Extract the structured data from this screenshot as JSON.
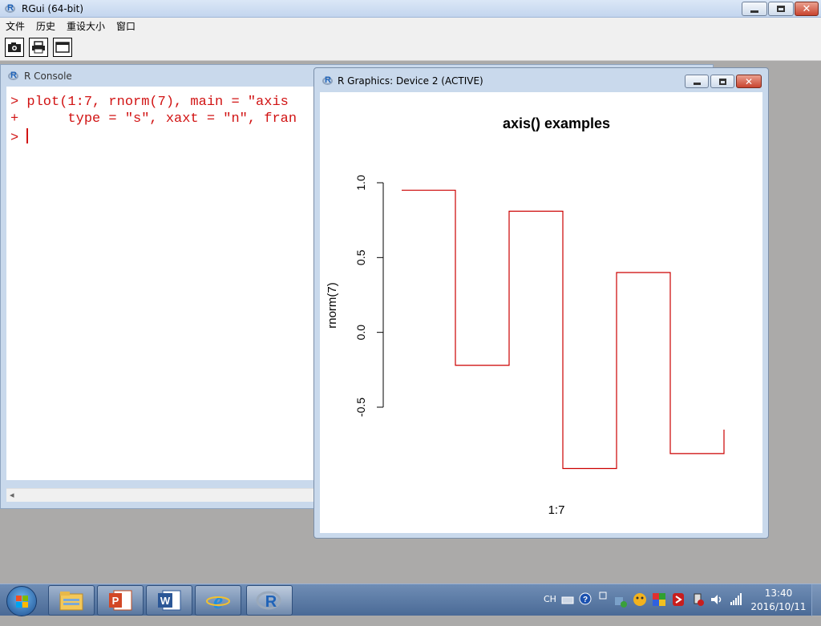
{
  "app": {
    "title": "RGui (64-bit)"
  },
  "menu": {
    "items": [
      "文件",
      "历史",
      "重设大小",
      "窗口"
    ]
  },
  "toolbar": {
    "icons": [
      "camera-icon",
      "print-icon",
      "window-icon"
    ]
  },
  "console": {
    "title": "R Console",
    "lines": [
      "> plot(1:7, rnorm(7), main = \"axis",
      "+      type = \"s\", xaxt = \"n\", fran",
      "> "
    ]
  },
  "graphics": {
    "title": "R Graphics: Device 2 (ACTIVE)"
  },
  "chart_data": {
    "type": "line",
    "title": "axis() examples",
    "xlabel": "1:7",
    "ylabel": "rnorm(7)",
    "x": [
      1,
      2,
      3,
      4,
      5,
      6,
      7
    ],
    "values": [
      0.95,
      -0.22,
      0.81,
      -0.91,
      0.4,
      -0.81,
      -0.65
    ],
    "step": "s",
    "ylim": [
      -0.5,
      1.0
    ],
    "yticks": [
      "-0.5",
      "0.0",
      "0.5",
      "1.0"
    ],
    "color": "#cc0000"
  },
  "taskbar": {
    "apps": [
      "explorer-icon",
      "powerpoint-icon",
      "word-icon",
      "ie-icon",
      "r-icon"
    ],
    "lang": "CH",
    "time": "13:40",
    "date": "2016/10/11"
  }
}
